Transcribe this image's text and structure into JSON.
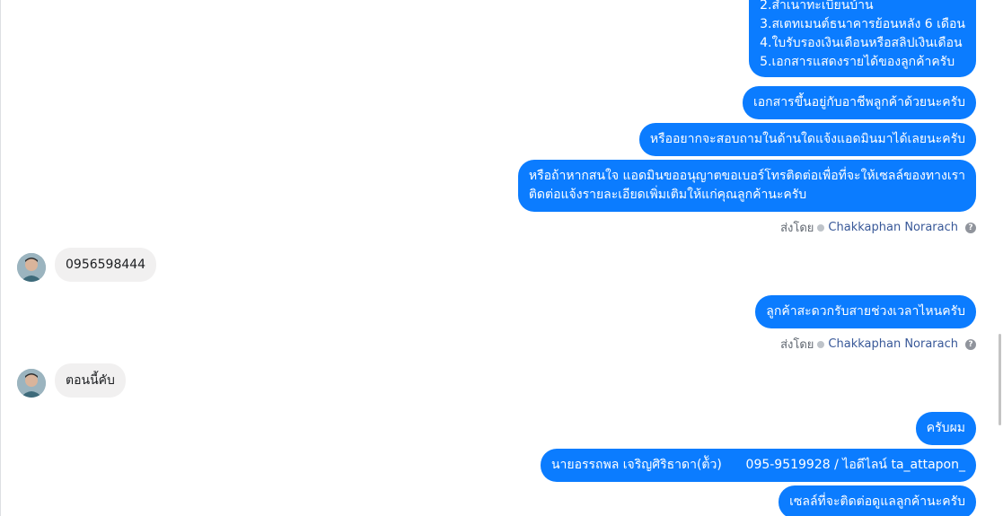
{
  "messages": {
    "doc_list": [
      "2.สำเนาทะเบียนบ้าน",
      "3.สเตทเมนต์ธนาคารย้อนหลัง 6 เดือน",
      "4.ใบรับรองเงินเดือนหรือสลิปเงินเดือน",
      "5.เอกสารแสดงรายได้ของลูกค้าครับ"
    ],
    "depends_on_job": "เอกสารขึ้นอยู่กับอาชีพลูกค้าด้วยนะครับ",
    "ask_questions": "หรืออยากจะสอบถามในด้านใดแจ้งแอดมินมาได้เลยนะครับ",
    "if_interested": [
      "หรือถ้าหากสนใจ แอดมินขออนุญาตขอเบอร์โทรติดต่อเพื่อที่จะให้เซลล์ของทางเรา",
      "ติดต่อแจ้งรายละเอียดเพิ่มเติมให้แก่คุณลูกค้านะครับ"
    ],
    "sent_by_label": "ส่งโดย",
    "sender_name": "Chakkaphan Norarach",
    "customer_phone": "0956598444",
    "convenient_time": "ลูกค้าสะดวกรับสายช่วงเวลาไหนครับ",
    "customer_now": "ตอนนี้คับ",
    "yes_sir": "ครับผม",
    "sales_contact": "นายอรรถพล เจริญศิริธาดา(ต้ัว)      095-9519928 / ไอดีไลน์ ta_attapon_",
    "sales_will_contact": "เซลล์ที่จะติดต่อดูแลลูกค้านะครับ"
  },
  "icons": {
    "verified": "check-circle-icon",
    "help": "question-mark-icon"
  },
  "colors": {
    "outgoing_bubble": "#0b7cff",
    "incoming_bubble": "#f1f0f0",
    "sender_link": "#385898"
  }
}
